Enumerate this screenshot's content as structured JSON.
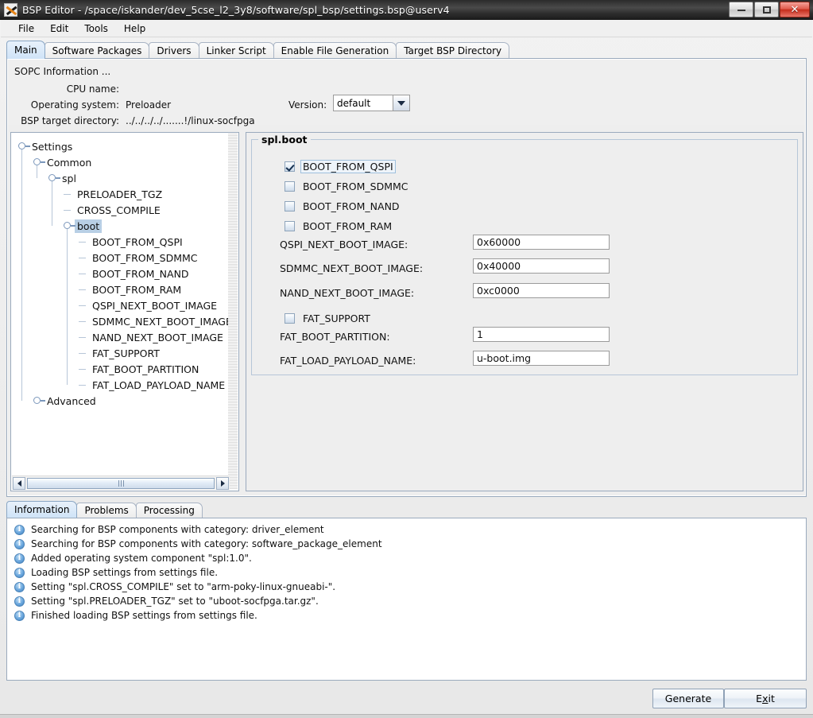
{
  "window": {
    "title": "BSP Editor - /space/iskander/dev_5cse_l2_3y8/software/spl_bsp/settings.bsp@userv4",
    "icon": "altera-x-icon",
    "controls": {
      "minimize": "–",
      "maximize": "□",
      "close": "✕"
    }
  },
  "menubar": {
    "items": [
      {
        "label": "File"
      },
      {
        "label": "Edit"
      },
      {
        "label": "Tools"
      },
      {
        "label": "Help"
      }
    ]
  },
  "tabs": {
    "items": [
      {
        "label": "Main",
        "selected": true
      },
      {
        "label": "Software Packages",
        "selected": false
      },
      {
        "label": "Drivers",
        "selected": false
      },
      {
        "label": "Linker Script",
        "selected": false
      },
      {
        "label": "Enable File Generation",
        "selected": false
      },
      {
        "label": "Target BSP Directory",
        "selected": false
      }
    ]
  },
  "sopc": {
    "heading": "SOPC Information ...",
    "cpu_name_label": "CPU name:",
    "cpu_name_value": "",
    "operating_system_label": "Operating system:",
    "operating_system_value": "Preloader",
    "version_label": "Version:",
    "version_value": "default",
    "bsp_target_directory_label": "BSP target directory:",
    "bsp_target_directory_value": "../../../../.......!/linux-socfpga"
  },
  "tree": {
    "nodes": [
      {
        "label": "Settings",
        "depth": 0,
        "expandable": true,
        "selected": false
      },
      {
        "label": "Common",
        "depth": 1,
        "expandable": true,
        "selected": false
      },
      {
        "label": "spl",
        "depth": 2,
        "expandable": true,
        "selected": false
      },
      {
        "label": "PRELOADER_TGZ",
        "depth": 3,
        "expandable": false,
        "selected": false
      },
      {
        "label": "CROSS_COMPILE",
        "depth": 3,
        "expandable": false,
        "selected": false
      },
      {
        "label": "boot",
        "depth": 3,
        "expandable": true,
        "selected": true
      },
      {
        "label": "BOOT_FROM_QSPI",
        "depth": 4,
        "expandable": false,
        "selected": false
      },
      {
        "label": "BOOT_FROM_SDMMC",
        "depth": 4,
        "expandable": false,
        "selected": false
      },
      {
        "label": "BOOT_FROM_NAND",
        "depth": 4,
        "expandable": false,
        "selected": false
      },
      {
        "label": "BOOT_FROM_RAM",
        "depth": 4,
        "expandable": false,
        "selected": false
      },
      {
        "label": "QSPI_NEXT_BOOT_IMAGE",
        "depth": 4,
        "expandable": false,
        "selected": false
      },
      {
        "label": "SDMMC_NEXT_BOOT_IMAGE",
        "depth": 4,
        "expandable": false,
        "selected": false
      },
      {
        "label": "NAND_NEXT_BOOT_IMAGE",
        "depth": 4,
        "expandable": false,
        "selected": false
      },
      {
        "label": "FAT_SUPPORT",
        "depth": 4,
        "expandable": false,
        "selected": false
      },
      {
        "label": "FAT_BOOT_PARTITION",
        "depth": 4,
        "expandable": false,
        "selected": false
      },
      {
        "label": "FAT_LOAD_PAYLOAD_NAME",
        "depth": 4,
        "expandable": false,
        "selected": false
      },
      {
        "label": "Advanced",
        "depth": 1,
        "expandable": true,
        "selected": false
      }
    ]
  },
  "detail": {
    "group_title": "spl.boot",
    "checkboxes": [
      {
        "label": "BOOT_FROM_QSPI",
        "checked": true,
        "focused": true
      },
      {
        "label": "BOOT_FROM_SDMMC",
        "checked": false,
        "focused": false
      },
      {
        "label": "BOOT_FROM_NAND",
        "checked": false,
        "focused": false
      },
      {
        "label": "BOOT_FROM_RAM",
        "checked": false,
        "focused": false
      }
    ],
    "fields": [
      {
        "label": "QSPI_NEXT_BOOT_IMAGE:",
        "value": "0x60000"
      },
      {
        "label": "SDMMC_NEXT_BOOT_IMAGE:",
        "value": "0x40000"
      },
      {
        "label": "NAND_NEXT_BOOT_IMAGE:",
        "value": "0xc0000"
      }
    ],
    "fat_checkbox": {
      "label": "FAT_SUPPORT",
      "checked": false
    },
    "fat_fields": [
      {
        "label": "FAT_BOOT_PARTITION:",
        "value": "1"
      },
      {
        "label": "FAT_LOAD_PAYLOAD_NAME:",
        "value": "u-boot.img"
      }
    ]
  },
  "log": {
    "tabs": [
      {
        "label": "Information",
        "selected": true
      },
      {
        "label": "Problems",
        "selected": false
      },
      {
        "label": "Processing",
        "selected": false
      }
    ],
    "icon": "info-icon",
    "icon_glyph": "i",
    "lines": [
      "Searching for BSP components with category: driver_element",
      "Searching for BSP components with category: software_package_element",
      "Added operating system component \"spl:1.0\".",
      "Loading BSP settings from settings file.",
      "Setting \"spl.CROSS_COMPILE\" set to \"arm-poky-linux-gnueabi-\".",
      "Setting \"spl.PRELOADER_TGZ\" set to \"uboot-socfpga.tar.gz\".",
      "Finished loading BSP settings from settings file."
    ]
  },
  "footer": {
    "generate_label": "Generate",
    "exit_label_pre": "E",
    "exit_label_mnem": "x",
    "exit_label_post": "it"
  },
  "colors": {
    "accent_selected": "#b8cfe5",
    "tab_selected": "#cfe3f7",
    "panel_bg": "#eeeeee",
    "close_button": "#c42d1c"
  }
}
